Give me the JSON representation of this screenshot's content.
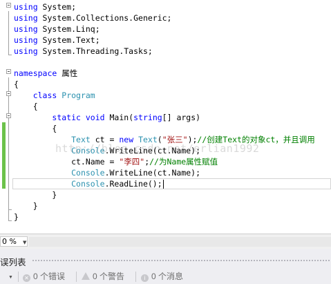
{
  "editor": {
    "lines": [
      {
        "id": "l1",
        "tokens": [
          [
            "kw",
            "using"
          ],
          [
            "",
            " System;"
          ]
        ]
      },
      {
        "id": "l2",
        "tokens": [
          [
            "kw",
            "using"
          ],
          [
            "",
            " System.Collections.Generic;"
          ]
        ]
      },
      {
        "id": "l3",
        "tokens": [
          [
            "kw",
            "using"
          ],
          [
            "",
            " System.Linq;"
          ]
        ]
      },
      {
        "id": "l4",
        "tokens": [
          [
            "kw",
            "using"
          ],
          [
            "",
            " System.Text;"
          ]
        ]
      },
      {
        "id": "l5",
        "tokens": [
          [
            "kw",
            "using"
          ],
          [
            "",
            " System.Threading.Tasks;"
          ]
        ]
      },
      {
        "id": "l6",
        "tokens": []
      },
      {
        "id": "l7",
        "tokens": [
          [
            "kw",
            "namespace"
          ],
          [
            "",
            " 属性"
          ]
        ]
      },
      {
        "id": "l8",
        "tokens": [
          [
            "",
            "{"
          ]
        ]
      },
      {
        "id": "l9",
        "tokens": [
          [
            "",
            "    "
          ],
          [
            "kw",
            "class"
          ],
          [
            "",
            " "
          ],
          [
            "ty",
            "Program"
          ]
        ]
      },
      {
        "id": "l10",
        "tokens": [
          [
            "",
            "    {"
          ]
        ]
      },
      {
        "id": "l11",
        "tokens": [
          [
            "",
            "        "
          ],
          [
            "kw",
            "static"
          ],
          [
            "",
            " "
          ],
          [
            "kw",
            "void"
          ],
          [
            "",
            " Main("
          ],
          [
            "kw",
            "string"
          ],
          [
            "",
            "[] args)"
          ]
        ]
      },
      {
        "id": "l12",
        "tokens": [
          [
            "",
            "        {"
          ]
        ]
      },
      {
        "id": "l13",
        "tokens": [
          [
            "",
            "            "
          ],
          [
            "ty",
            "Text"
          ],
          [
            "",
            " ct = "
          ],
          [
            "kw",
            "new"
          ],
          [
            "",
            " "
          ],
          [
            "ty",
            "Text"
          ],
          [
            "",
            "("
          ],
          [
            "str",
            "\"张三\""
          ],
          [
            "",
            ");"
          ],
          [
            "cm",
            "//创建Text的对象ct，并且调用"
          ]
        ]
      },
      {
        "id": "l14",
        "tokens": [
          [
            "",
            "            "
          ],
          [
            "ty",
            "Console"
          ],
          [
            "",
            ".WriteLine(ct.Name);"
          ]
        ]
      },
      {
        "id": "l15",
        "tokens": [
          [
            "",
            "            ct.Name = "
          ],
          [
            "str",
            "\"李四\""
          ],
          [
            "",
            ";"
          ],
          [
            "cm",
            "//为Name属性赋值"
          ]
        ]
      },
      {
        "id": "l16",
        "tokens": [
          [
            "",
            "            "
          ],
          [
            "ty",
            "Console"
          ],
          [
            "",
            ".WriteLine(ct.Name);"
          ]
        ]
      },
      {
        "id": "l17",
        "tokens": [
          [
            "",
            "            "
          ],
          [
            "ty",
            "Console"
          ],
          [
            "",
            ".ReadLine();"
          ]
        ]
      },
      {
        "id": "l18",
        "tokens": [
          [
            "",
            "        }"
          ]
        ]
      },
      {
        "id": "l19",
        "tokens": [
          [
            "",
            "    }"
          ]
        ]
      },
      {
        "id": "l20",
        "tokens": [
          [
            "",
            "}"
          ]
        ]
      }
    ],
    "watermark": "http://blog.csdn.net/erlian1992"
  },
  "statusbar": {
    "zoom": "0 %"
  },
  "error_list": {
    "title": "误列表",
    "errors": "0 个错误",
    "warnings": "0 个警告",
    "messages": "0 个消息"
  },
  "colors": {
    "keyword": "#0000ff",
    "type": "#2b91af",
    "string": "#a31515",
    "comment": "#008000",
    "change_bar": "#6cc24a"
  },
  "icons": [
    "collapse-icon",
    "dropdown-arrow-icon",
    "error-icon",
    "warning-icon",
    "info-icon"
  ]
}
